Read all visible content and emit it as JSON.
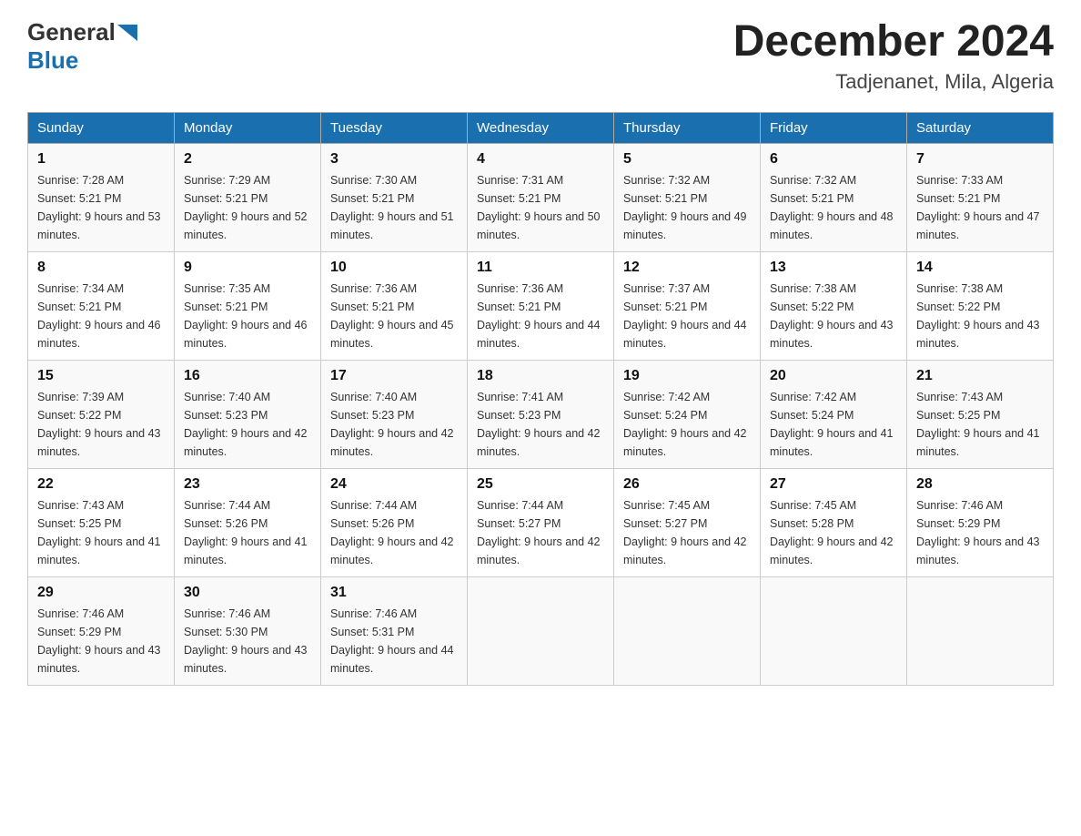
{
  "header": {
    "logo_general": "General",
    "logo_blue": "Blue",
    "month_year": "December 2024",
    "location": "Tadjenanet, Mila, Algeria"
  },
  "calendar": {
    "days_of_week": [
      "Sunday",
      "Monday",
      "Tuesday",
      "Wednesday",
      "Thursday",
      "Friday",
      "Saturday"
    ],
    "weeks": [
      [
        {
          "day": "1",
          "sunrise": "7:28 AM",
          "sunset": "5:21 PM",
          "daylight": "9 hours and 53 minutes."
        },
        {
          "day": "2",
          "sunrise": "7:29 AM",
          "sunset": "5:21 PM",
          "daylight": "9 hours and 52 minutes."
        },
        {
          "day": "3",
          "sunrise": "7:30 AM",
          "sunset": "5:21 PM",
          "daylight": "9 hours and 51 minutes."
        },
        {
          "day": "4",
          "sunrise": "7:31 AM",
          "sunset": "5:21 PM",
          "daylight": "9 hours and 50 minutes."
        },
        {
          "day": "5",
          "sunrise": "7:32 AM",
          "sunset": "5:21 PM",
          "daylight": "9 hours and 49 minutes."
        },
        {
          "day": "6",
          "sunrise": "7:32 AM",
          "sunset": "5:21 PM",
          "daylight": "9 hours and 48 minutes."
        },
        {
          "day": "7",
          "sunrise": "7:33 AM",
          "sunset": "5:21 PM",
          "daylight": "9 hours and 47 minutes."
        }
      ],
      [
        {
          "day": "8",
          "sunrise": "7:34 AM",
          "sunset": "5:21 PM",
          "daylight": "9 hours and 46 minutes."
        },
        {
          "day": "9",
          "sunrise": "7:35 AM",
          "sunset": "5:21 PM",
          "daylight": "9 hours and 46 minutes."
        },
        {
          "day": "10",
          "sunrise": "7:36 AM",
          "sunset": "5:21 PM",
          "daylight": "9 hours and 45 minutes."
        },
        {
          "day": "11",
          "sunrise": "7:36 AM",
          "sunset": "5:21 PM",
          "daylight": "9 hours and 44 minutes."
        },
        {
          "day": "12",
          "sunrise": "7:37 AM",
          "sunset": "5:21 PM",
          "daylight": "9 hours and 44 minutes."
        },
        {
          "day": "13",
          "sunrise": "7:38 AM",
          "sunset": "5:22 PM",
          "daylight": "9 hours and 43 minutes."
        },
        {
          "day": "14",
          "sunrise": "7:38 AM",
          "sunset": "5:22 PM",
          "daylight": "9 hours and 43 minutes."
        }
      ],
      [
        {
          "day": "15",
          "sunrise": "7:39 AM",
          "sunset": "5:22 PM",
          "daylight": "9 hours and 43 minutes."
        },
        {
          "day": "16",
          "sunrise": "7:40 AM",
          "sunset": "5:23 PM",
          "daylight": "9 hours and 42 minutes."
        },
        {
          "day": "17",
          "sunrise": "7:40 AM",
          "sunset": "5:23 PM",
          "daylight": "9 hours and 42 minutes."
        },
        {
          "day": "18",
          "sunrise": "7:41 AM",
          "sunset": "5:23 PM",
          "daylight": "9 hours and 42 minutes."
        },
        {
          "day": "19",
          "sunrise": "7:42 AM",
          "sunset": "5:24 PM",
          "daylight": "9 hours and 42 minutes."
        },
        {
          "day": "20",
          "sunrise": "7:42 AM",
          "sunset": "5:24 PM",
          "daylight": "9 hours and 41 minutes."
        },
        {
          "day": "21",
          "sunrise": "7:43 AM",
          "sunset": "5:25 PM",
          "daylight": "9 hours and 41 minutes."
        }
      ],
      [
        {
          "day": "22",
          "sunrise": "7:43 AM",
          "sunset": "5:25 PM",
          "daylight": "9 hours and 41 minutes."
        },
        {
          "day": "23",
          "sunrise": "7:44 AM",
          "sunset": "5:26 PM",
          "daylight": "9 hours and 41 minutes."
        },
        {
          "day": "24",
          "sunrise": "7:44 AM",
          "sunset": "5:26 PM",
          "daylight": "9 hours and 42 minutes."
        },
        {
          "day": "25",
          "sunrise": "7:44 AM",
          "sunset": "5:27 PM",
          "daylight": "9 hours and 42 minutes."
        },
        {
          "day": "26",
          "sunrise": "7:45 AM",
          "sunset": "5:27 PM",
          "daylight": "9 hours and 42 minutes."
        },
        {
          "day": "27",
          "sunrise": "7:45 AM",
          "sunset": "5:28 PM",
          "daylight": "9 hours and 42 minutes."
        },
        {
          "day": "28",
          "sunrise": "7:46 AM",
          "sunset": "5:29 PM",
          "daylight": "9 hours and 43 minutes."
        }
      ],
      [
        {
          "day": "29",
          "sunrise": "7:46 AM",
          "sunset": "5:29 PM",
          "daylight": "9 hours and 43 minutes."
        },
        {
          "day": "30",
          "sunrise": "7:46 AM",
          "sunset": "5:30 PM",
          "daylight": "9 hours and 43 minutes."
        },
        {
          "day": "31",
          "sunrise": "7:46 AM",
          "sunset": "5:31 PM",
          "daylight": "9 hours and 44 minutes."
        },
        null,
        null,
        null,
        null
      ]
    ]
  }
}
